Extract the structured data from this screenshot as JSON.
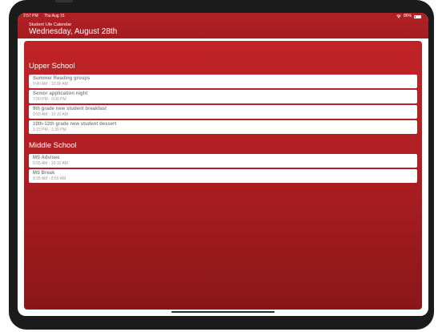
{
  "status_bar": {
    "time": "2:57 PM",
    "date": "Thu Aug 15",
    "battery_text": "86%",
    "battery_level": 0.86,
    "wifi_icon": "wifi-icon",
    "battery_icon": "battery-icon"
  },
  "header": {
    "subtitle": "Student Life Calendar",
    "title": "Wednesday, August 28th",
    "color": "#b02125"
  },
  "sections": [
    {
      "heading": "Upper School",
      "events": [
        {
          "title": "Summer Reading groups",
          "time": "9:40 AM - 10:00 AM"
        },
        {
          "title": "Senior application night",
          "time": "7:00 PM - 9:00 PM"
        },
        {
          "title": "9th grade new student breakfast",
          "time": "9:55 AM - 10:10 AM"
        },
        {
          "title": "10th-12th grade new student dessert",
          "time": "1:15 PM - 1:30 PM"
        }
      ]
    },
    {
      "heading": "Middle School",
      "events": [
        {
          "title": "MS Advisee",
          "time": "9:55 AM - 10:10 AM"
        },
        {
          "title": "MS Break",
          "time": "9:35 AM - 9:50 AM"
        }
      ]
    }
  ]
}
